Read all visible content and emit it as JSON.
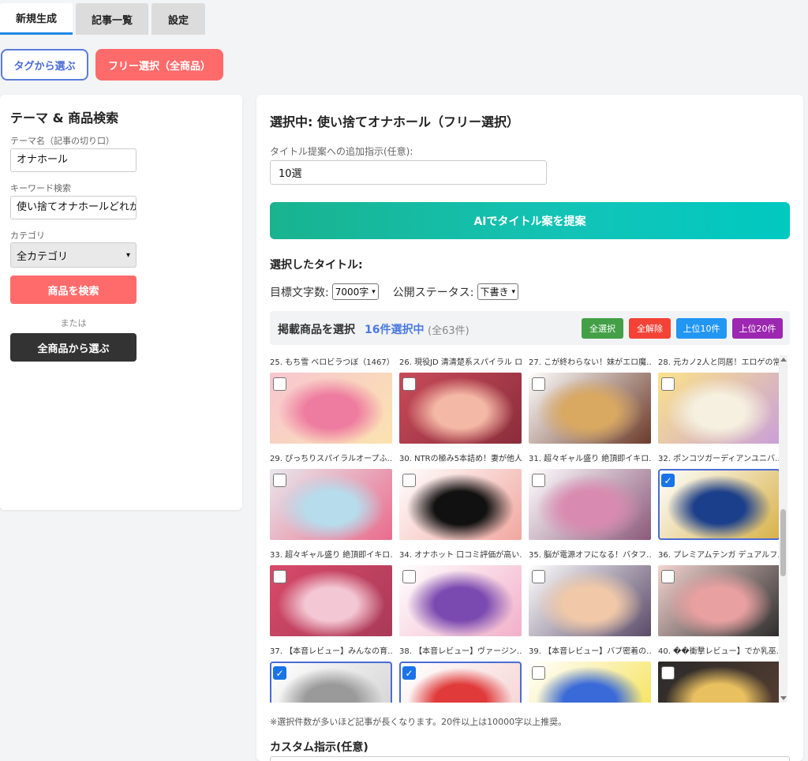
{
  "tabs": [
    {
      "label": "新規生成",
      "active": true
    },
    {
      "label": "記事一覧",
      "active": false
    },
    {
      "label": "設定",
      "active": false
    }
  ],
  "mode": {
    "tag_label": "タグから選ぶ",
    "free_label": "フリー選択（全商品）"
  },
  "left": {
    "title": "テーマ & 商品検索",
    "theme_label": "テーマ名（記事の切り口）",
    "theme_value": "オナホール",
    "keyword_label": "キーワード検索",
    "keyword_value": "使い捨てオナホールどれが",
    "category_label": "カテゴリ",
    "category_value": "全カテゴリ",
    "search_button": "商品を検索",
    "or_text": "または",
    "all_button": "全商品から選ぶ"
  },
  "right": {
    "heading": "選択中: 使い捨てオナホール（フリー選択）",
    "extra_label": "タイトル提案への追加指示(任意):",
    "extra_value": "10選",
    "ai_button": "AIでタイトル案を提案",
    "selected_title": "選択したタイトル:",
    "target_label": "目標文字数:",
    "target_value": "7000字",
    "status_label": "公開ステータス:",
    "status_value": "下書き",
    "products_title": "掲載商品を選択",
    "products_selected": "16件選択中",
    "products_total": "(全63件)",
    "btn_all": "全選択",
    "btn_none": "全解除",
    "btn_top10": "上位10件",
    "btn_top20": "上位20件",
    "note": "※選択件数が多いほど記事が長くなります。20件以上は10000字以上推奨。",
    "custom_title": "カスタム指示(任意)"
  },
  "products": [
    {
      "title": "25. もち雪 ベロビラつぼ（1467）…",
      "checked": false,
      "colors": [
        "#f7c6d0",
        "#ee7ba0",
        "#fbe3b0"
      ]
    },
    {
      "title": "26. 現役JD 清清楚系スパイラル ロ…",
      "checked": false,
      "colors": [
        "#c94a5a",
        "#f4b8a6",
        "#8a2d3b"
      ]
    },
    {
      "title": "27. こが終わらない！妹がエロ魔…",
      "checked": false,
      "colors": [
        "#ffffff",
        "#d9a861",
        "#6b3b2a"
      ]
    },
    {
      "title": "28. 元カノ2人と同居！エロゲの常…",
      "checked": false,
      "colors": [
        "#fbe38a",
        "#f5f0e0",
        "#c9a0d8"
      ]
    },
    {
      "title": "29. ぴっちりスパイラルオープふ…",
      "checked": false,
      "colors": [
        "#e8e8ec",
        "#b7dcec",
        "#e96b8c"
      ]
    },
    {
      "title": "30. NTRの極み5本詰め！妻が他人…",
      "checked": false,
      "colors": [
        "#ffffff",
        "#111111",
        "#f1a7a0"
      ]
    },
    {
      "title": "31. 超々ギャル盛り 絶頂即イキロ…",
      "checked": false,
      "colors": [
        "#ffffff",
        "#d98ab0",
        "#8b5a7a"
      ]
    },
    {
      "title": "32. ポンコツガーディアンユニバ…",
      "checked": true,
      "colors": [
        "#ffffff",
        "#1b3f8a",
        "#d8b24a"
      ]
    },
    {
      "title": "33. 超々ギャル盛り 絶頂即イキロ…",
      "checked": false,
      "colors": [
        "#d94a6a",
        "#f3c7d3",
        "#a83a57"
      ]
    },
    {
      "title": "34. オナホット 口コミ評価が高い…",
      "checked": false,
      "colors": [
        "#ffffff",
        "#7b4ab0",
        "#f2b0c8"
      ]
    },
    {
      "title": "35. 脳が電源オフになる！バタフ…",
      "checked": false,
      "colors": [
        "#ffffff",
        "#f2c9a8",
        "#5a4a68"
      ]
    },
    {
      "title": "36. プレミアムテンガ デュアルフ…",
      "checked": false,
      "colors": [
        "#f3d4d0",
        "#e9a0a0",
        "#2b2b2b"
      ]
    },
    {
      "title": "37. 【本音レビュー】みんなの育…",
      "checked": true,
      "colors": [
        "#ffffff",
        "#9a9a9a",
        "#d0d0d0"
      ]
    },
    {
      "title": "38. 【本音レビュー】ヴァージン…",
      "checked": true,
      "colors": [
        "#ffffff",
        "#e03a3a",
        "#f5d0d0"
      ]
    },
    {
      "title": "39. 【本音レビュー】バブ密着の…",
      "checked": false,
      "colors": [
        "#ffffff",
        "#3a6ad8",
        "#f5e04a"
      ]
    },
    {
      "title": "40. ��衝撃レビュー】でか乳巫…",
      "checked": false,
      "colors": [
        "#2a2a2a",
        "#e8c060",
        "#5a4030"
      ]
    }
  ]
}
